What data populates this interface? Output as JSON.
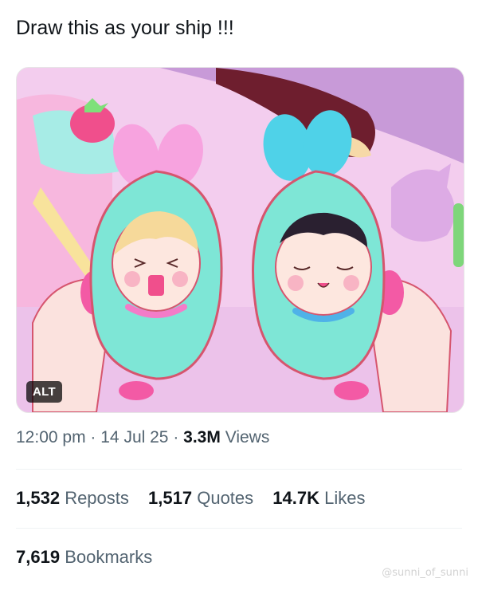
{
  "tweet": {
    "text": "Draw this as your ship !!!"
  },
  "media": {
    "alt_label": "ALT",
    "watermark": "@sunni_of_sunni"
  },
  "meta": {
    "time": "12:00 pm",
    "sep1": "·",
    "date": "14 Jul 25",
    "sep2": "·",
    "views_count": "3.3M",
    "views_label": "Views"
  },
  "stats": {
    "reposts_count": "1,532",
    "reposts_label": "Reposts",
    "quotes_count": "1,517",
    "quotes_label": "Quotes",
    "likes_count": "14.7K",
    "likes_label": "Likes",
    "bookmarks_count": "7,619",
    "bookmarks_label": "Bookmarks"
  }
}
